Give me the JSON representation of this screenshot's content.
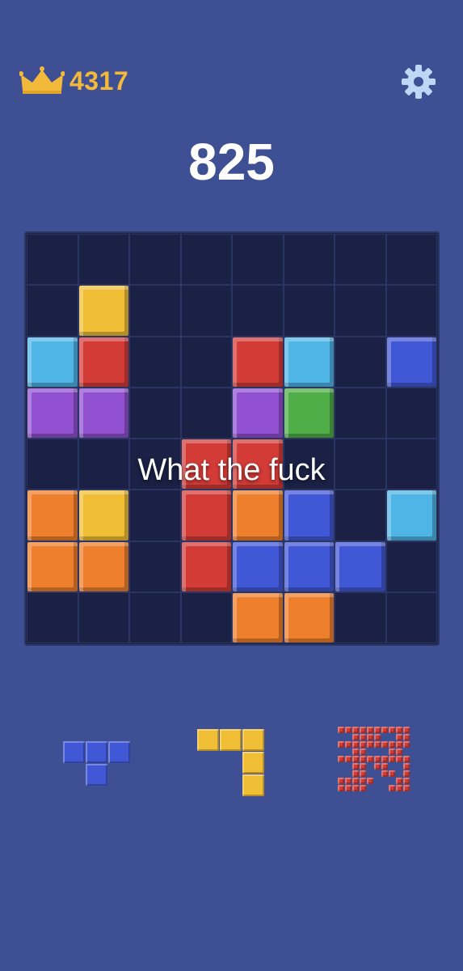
{
  "header": {
    "best_score": "4317",
    "score": "825",
    "crown_icon": "crown-icon",
    "settings_icon": "gear-icon"
  },
  "overlay": {
    "caption": "What the fuck"
  },
  "colors": {
    "background": "#3e4f93",
    "board": "#1c2347",
    "yellow": "#efbe35",
    "red": "#d33b37",
    "lightblue": "#4fb5e6",
    "blue": "#4057d6",
    "purple": "#9151d1",
    "green": "#4fae47",
    "orange": "#ee7f2c"
  },
  "board": {
    "rows": 8,
    "cols": 8,
    "cells": [
      [
        "",
        "",
        "",
        "",
        "",
        "",
        "",
        ""
      ],
      [
        "",
        "yellow",
        "",
        "",
        "",
        "",
        "",
        ""
      ],
      [
        "lightblue",
        "red",
        "",
        "",
        "red",
        "lightblue",
        "",
        "blue"
      ],
      [
        "purple",
        "purple",
        "",
        "",
        "purple",
        "green",
        "",
        ""
      ],
      [
        "",
        "",
        "",
        "red",
        "red",
        "",
        "",
        ""
      ],
      [
        "orange",
        "yellow",
        "",
        "red",
        "orange",
        "blue",
        "",
        "lightblue"
      ],
      [
        "orange",
        "orange",
        "",
        "red",
        "blue",
        "blue",
        "blue",
        ""
      ],
      [
        "",
        "",
        "",
        "",
        "orange",
        "orange",
        "",
        ""
      ]
    ]
  },
  "tray": {
    "pieces": [
      {
        "name": "tray-piece-t",
        "color": "blue",
        "shape": [
          [
            1,
            1,
            1
          ],
          [
            0,
            1,
            0
          ]
        ]
      },
      {
        "name": "tray-piece-corner",
        "color": "yellow",
        "shape": [
          [
            1,
            1,
            1
          ],
          [
            0,
            0,
            1
          ],
          [
            0,
            0,
            1
          ]
        ]
      },
      {
        "name": "tray-piece-red",
        "color": "red",
        "shape": [
          [
            1,
            1,
            1,
            1,
            1,
            1,
            1,
            1,
            1,
            1
          ],
          [
            0,
            0,
            1,
            1,
            1,
            1,
            0,
            0,
            1,
            1
          ],
          [
            1,
            1,
            1,
            1,
            1,
            1,
            1,
            1,
            1,
            1
          ],
          [
            0,
            0,
            1,
            1,
            0,
            0,
            0,
            1,
            1,
            0
          ],
          [
            1,
            1,
            1,
            1,
            1,
            1,
            1,
            1,
            1,
            1
          ],
          [
            0,
            0,
            1,
            1,
            0,
            1,
            1,
            0,
            0,
            1
          ],
          [
            0,
            0,
            1,
            1,
            0,
            0,
            1,
            1,
            0,
            1
          ],
          [
            1,
            1,
            1,
            1,
            1,
            0,
            0,
            0,
            1,
            1
          ],
          [
            1,
            1,
            1,
            1,
            0,
            0,
            0,
            1,
            1,
            1
          ]
        ]
      }
    ]
  }
}
